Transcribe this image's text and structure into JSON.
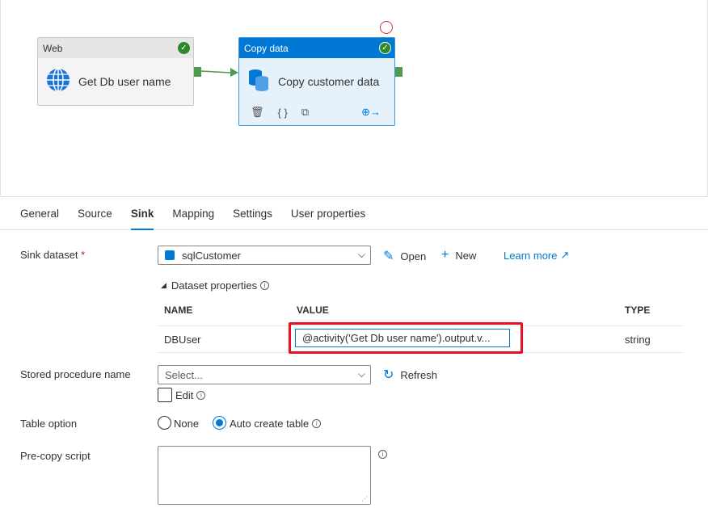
{
  "pipeline": {
    "web_activity": {
      "type_label": "Web",
      "name": "Get Db user name"
    },
    "copy_activity": {
      "type_label": "Copy data",
      "name": "Copy customer data"
    }
  },
  "tabs": [
    "General",
    "Source",
    "Sink",
    "Mapping",
    "Settings",
    "User properties"
  ],
  "active_tab": "Sink",
  "sink": {
    "dataset_label": "Sink dataset",
    "required_mark": "*",
    "dataset_value": "sqlCustomer",
    "open_label": "Open",
    "new_label": "New",
    "learn_more_label": "Learn more",
    "dataset_props_label": "Dataset properties",
    "columns": {
      "name": "NAME",
      "value": "VALUE",
      "type": "TYPE"
    },
    "row": {
      "name": "DBUser",
      "value": "@activity('Get Db user name').output.v...",
      "type": "string"
    },
    "stored_proc_label": "Stored procedure name",
    "stored_proc_placeholder": "Select...",
    "refresh_label": "Refresh",
    "edit_label": "Edit",
    "table_option_label": "Table option",
    "option_none": "None",
    "option_auto": "Auto create table",
    "selected_table_option": "Auto create table",
    "precopy_label": "Pre-copy script"
  },
  "colors": {
    "accent": "#0078d4",
    "success": "#2a8a2a",
    "highlight": "#e81123"
  }
}
